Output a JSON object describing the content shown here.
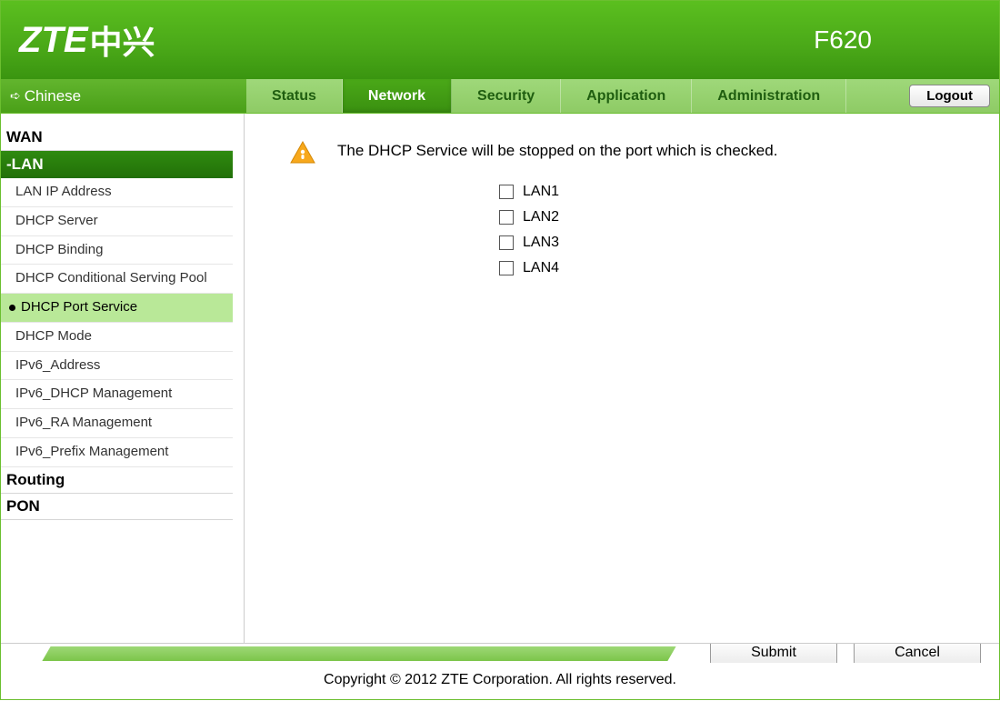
{
  "header": {
    "logo_latin": "ZTE",
    "logo_cn": "中兴",
    "model": "F620"
  },
  "topnav": {
    "lang_label": "Chinese",
    "tabs": [
      {
        "label": "Status",
        "active": false
      },
      {
        "label": "Network",
        "active": true
      },
      {
        "label": "Security",
        "active": false
      },
      {
        "label": "Application",
        "active": false
      },
      {
        "label": "Administration",
        "active": false
      }
    ],
    "logout_label": "Logout"
  },
  "sidebar": {
    "groups": [
      {
        "label": "WAN",
        "active": false,
        "items": []
      },
      {
        "label": "-LAN",
        "active": true,
        "items": [
          {
            "label": "LAN IP Address",
            "selected": false
          },
          {
            "label": "DHCP Server",
            "selected": false
          },
          {
            "label": "DHCP Binding",
            "selected": false
          },
          {
            "label": "DHCP Conditional Serving Pool",
            "selected": false
          },
          {
            "label": "DHCP Port Service",
            "selected": true
          },
          {
            "label": "DHCP Mode",
            "selected": false
          },
          {
            "label": "IPv6_Address",
            "selected": false
          },
          {
            "label": "IPv6_DHCP Management",
            "selected": false
          },
          {
            "label": "IPv6_RA Management",
            "selected": false
          },
          {
            "label": "IPv6_Prefix Management",
            "selected": false
          }
        ]
      },
      {
        "label": "Routing",
        "active": false,
        "items": []
      },
      {
        "label": "PON",
        "active": false,
        "items": []
      }
    ]
  },
  "content": {
    "info_text": "The DHCP Service will be stopped on the port which is checked.",
    "lan_ports": [
      {
        "label": "LAN1",
        "checked": false
      },
      {
        "label": "LAN2",
        "checked": false
      },
      {
        "label": "LAN3",
        "checked": false
      },
      {
        "label": "LAN4",
        "checked": false
      }
    ]
  },
  "footer": {
    "submit_label": "Submit",
    "cancel_label": "Cancel",
    "copyright": "Copyright © 2012 ZTE Corporation. All rights reserved."
  }
}
